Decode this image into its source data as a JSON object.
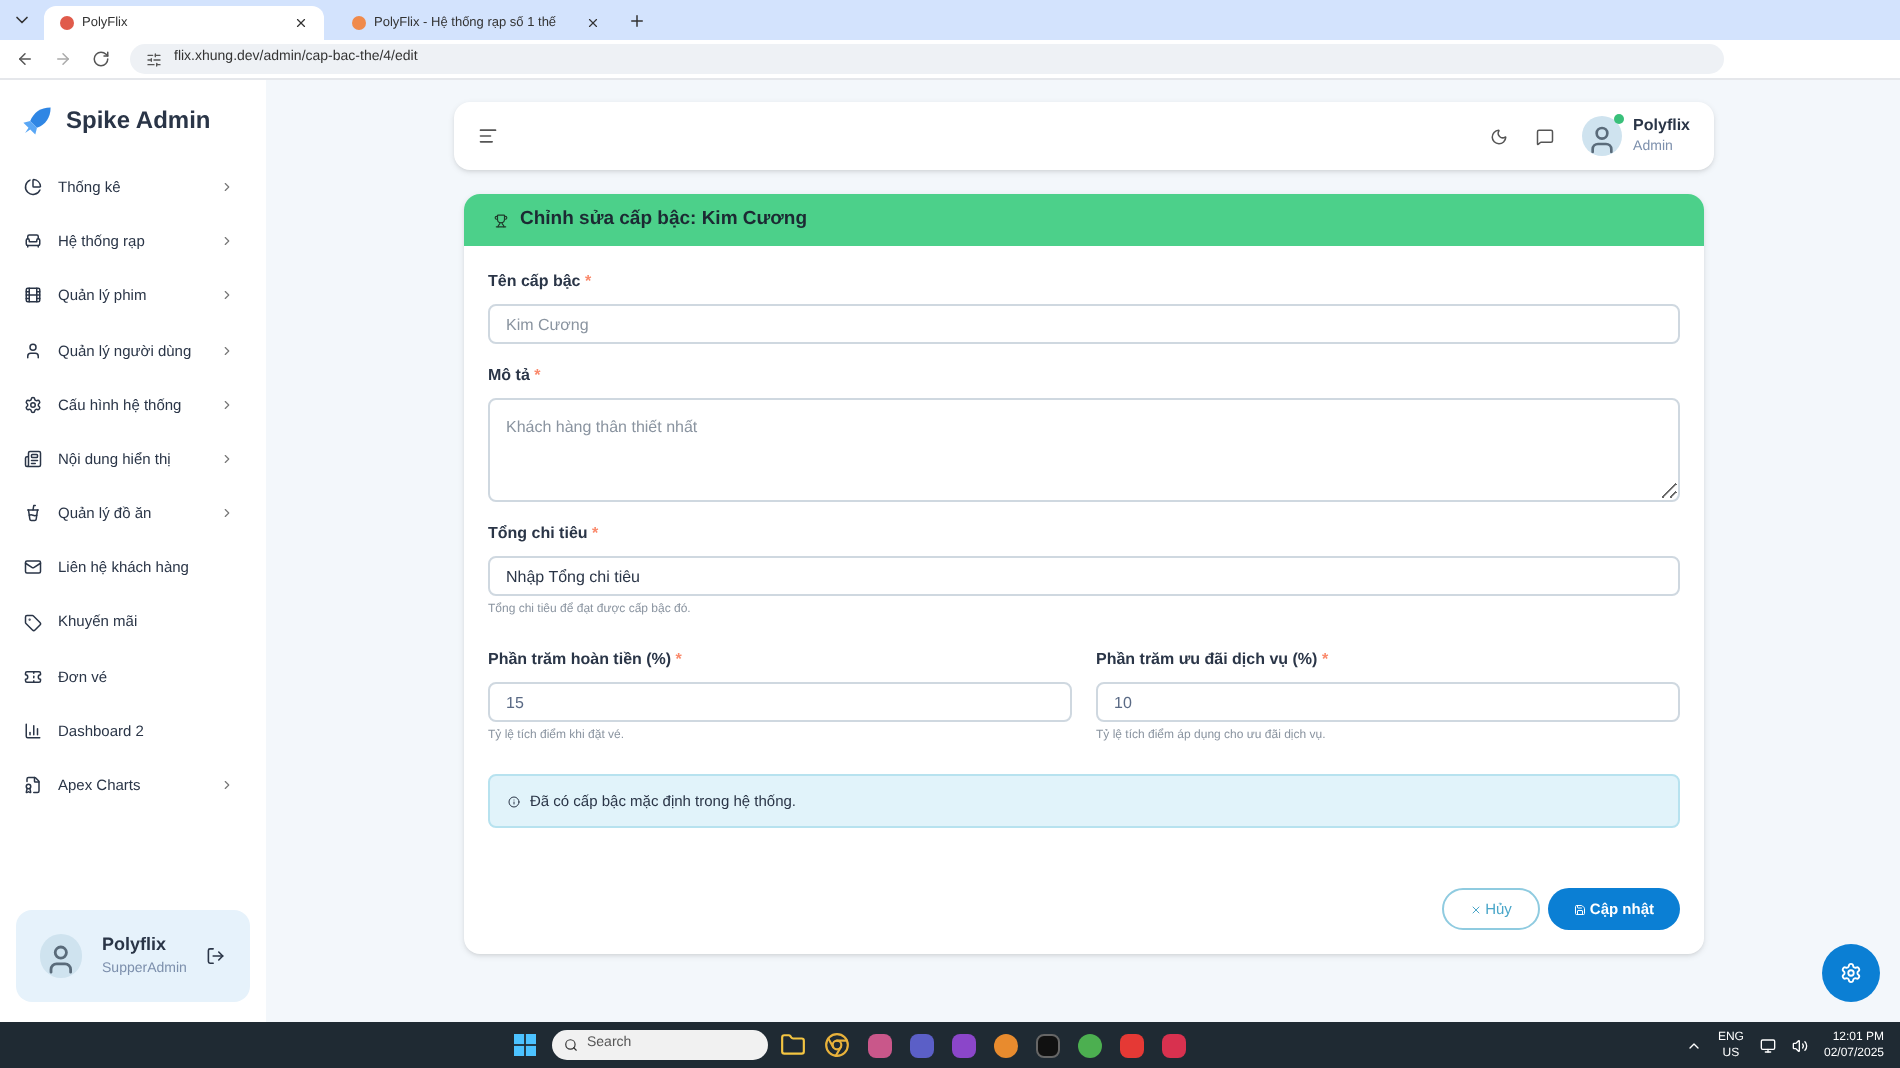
{
  "browser": {
    "tabs": [
      {
        "title": "PolyFlix",
        "selected": true
      },
      {
        "title": "PolyFlix - Hệ thống rạp số 1 thế",
        "selected": false
      }
    ],
    "url": "flix.xhung.dev/admin/cap-bac-the/4/edit"
  },
  "sidebar": {
    "brand": "Spike Admin",
    "items": [
      {
        "label": "Thống kê",
        "expandable": true
      },
      {
        "label": "Hệ thống rạp",
        "expandable": true
      },
      {
        "label": "Quản lý phim",
        "expandable": true
      },
      {
        "label": "Quản lý người dùng",
        "expandable": true
      },
      {
        "label": "Cấu hình hệ thống",
        "expandable": true
      },
      {
        "label": "Nội dung hiển thị",
        "expandable": true
      },
      {
        "label": "Quản lý đồ ăn",
        "expandable": true
      },
      {
        "label": "Liên hệ khách hàng",
        "expandable": false
      },
      {
        "label": "Khuyến mãi",
        "expandable": false
      },
      {
        "label": "Đơn vé",
        "expandable": false
      },
      {
        "label": "Dashboard 2",
        "expandable": false
      },
      {
        "label": "Apex Charts",
        "expandable": true
      }
    ],
    "profile": {
      "name": "Polyflix",
      "role": "SupperAdmin"
    }
  },
  "header": {
    "user": {
      "name": "Polyflix",
      "role": "Admin",
      "online": true
    }
  },
  "form": {
    "title": "Chỉnh sửa cấp bậc: Kim Cương",
    "fields": [
      {
        "label": "Tên cấp bậc",
        "required_mark": "*",
        "kind": "input",
        "placeholder": "Kim Cương"
      },
      {
        "label": "Mô tả",
        "required_mark": "*",
        "kind": "textarea",
        "placeholder": "Khách hàng thân thiết nhất"
      },
      {
        "label": "Tổng chi tiêu",
        "required_mark": "*",
        "kind": "input",
        "value": "Nhập Tổng chi tiêu",
        "help": "Tổng chi tiêu để đạt được cấp bậc đó."
      }
    ],
    "pair": [
      {
        "label": "Phần trăm hoàn tiền (%)",
        "required_mark": "*",
        "kind": "input",
        "value": "15",
        "help": "Tỷ lệ tích điểm khi đặt vé."
      },
      {
        "label": "Phần trăm ưu đãi dịch vụ (%)",
        "required_mark": "*",
        "kind": "input",
        "value": "10",
        "help": "Tỷ lệ tích điểm áp dụng cho ưu đãi dịch vụ."
      }
    ],
    "notice": "Đã có cấp bậc mặc định trong hệ thống.",
    "buttons": {
      "cancel": "Hủy",
      "submit": "Cập nhật"
    }
  },
  "taskbar": {
    "search": "Search",
    "language": "ENG",
    "region": "US",
    "time": "12:01 PM",
    "date": "02/07/2025"
  }
}
